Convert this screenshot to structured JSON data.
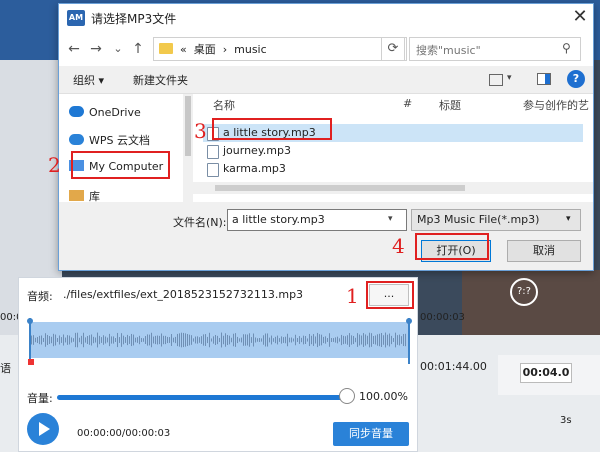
{
  "dialog": {
    "app_icon": "AM",
    "title": "请选择MP3文件",
    "close_glyph": "✕",
    "nav": {
      "back": "←",
      "forward": "→",
      "down": "⌄",
      "up": "↑"
    },
    "breadcrumb": [
      "桌面",
      "music"
    ],
    "breadcrumb_sep": "›",
    "breadcrumb_prefix": "«",
    "search_placeholder": "搜索\"music\"",
    "toolbar": {
      "organize": "组织 ▾",
      "new_folder": "新建文件夹",
      "help": "?"
    },
    "navpane": [
      {
        "label": "OneDrive",
        "icon": "cloud-icon",
        "color": "#1e78d4"
      },
      {
        "label": "WPS 云文档",
        "icon": "wps-cloud-icon",
        "color": "#2a82d8"
      },
      {
        "label": "My Computer",
        "icon": "computer-icon",
        "color": "#4a90e2"
      },
      {
        "label": "库",
        "icon": "library-icon",
        "color": "#e2a84a"
      }
    ],
    "columns": [
      "名称",
      "#",
      "标题",
      "参与创作的艺"
    ],
    "files": [
      {
        "name": "a little story.mp3",
        "selected": true
      },
      {
        "name": "journey.mp3",
        "selected": false
      },
      {
        "name": "karma.mp3",
        "selected": false
      }
    ],
    "filename_label": "文件名(N):",
    "filename_value": "a little story.mp3",
    "filter_value": "Mp3 Music File(*.mp3)",
    "open_button": "打开(O)",
    "cancel_button": "取消"
  },
  "annotations": [
    "1",
    "2",
    "3",
    "4"
  ],
  "audio": {
    "label": "音频:",
    "path": "./files/extfiles/ext_2018523152732113.mp3",
    "browse": "...",
    "start_time": "00:00",
    "end_time": "00:00:03",
    "volume_label": "音量:",
    "volume_value": "100.00%",
    "volume_fraction": 1.0,
    "time_display": "00:00:00/00:00:03",
    "sync_button": "同步音量"
  },
  "background": {
    "timecode": "00:01:44.00",
    "duration_value": "00:04.0",
    "seconds_label": "3s",
    "side_label": "语",
    "badge": "?:?"
  },
  "colors": {
    "accent": "#2a82d8",
    "annotation": "#e02020",
    "selection": "#cce4f7"
  }
}
